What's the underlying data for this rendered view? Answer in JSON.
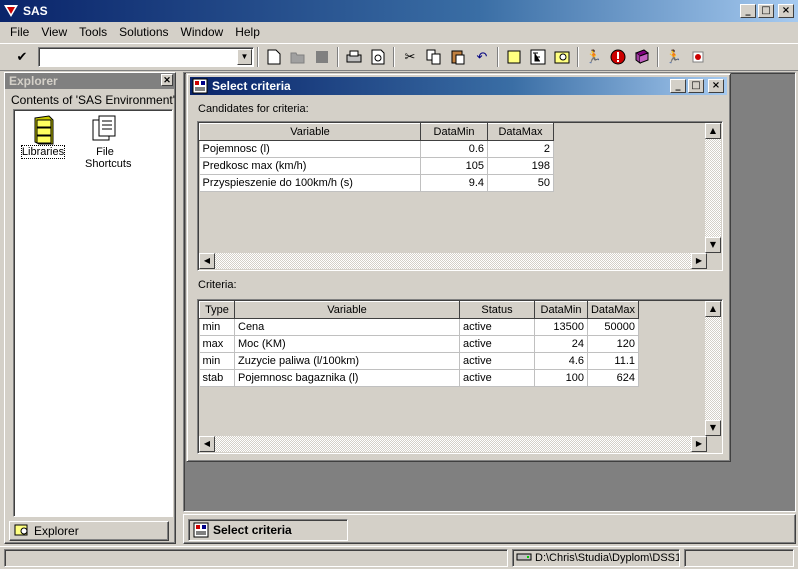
{
  "app": {
    "title": "SAS"
  },
  "menu": [
    "File",
    "View",
    "Tools",
    "Solutions",
    "Window",
    "Help"
  ],
  "toolbar": {
    "command_value": ""
  },
  "explorer": {
    "header": "Explorer",
    "contents_label": "Contents of 'SAS Environment'",
    "items": [
      {
        "label": "Libraries",
        "icon": "cabinet-icon"
      },
      {
        "label": "File Shortcuts",
        "icon": "file-shortcuts-icon"
      }
    ],
    "tab_label": "Explorer"
  },
  "child_window": {
    "title": "Select criteria",
    "candidates_label": "Candidates for criteria:",
    "candidates_columns": [
      "Variable",
      "DataMin",
      "DataMax"
    ],
    "candidates_rows": [
      {
        "variable": "Pojemnosc (l)",
        "datamin": "0.6",
        "datamax": "2"
      },
      {
        "variable": "Predkosc max (km/h)",
        "datamin": "105",
        "datamax": "198"
      },
      {
        "variable": "Przyspieszenie do 100km/h (s)",
        "datamin": "9.4",
        "datamax": "50"
      }
    ],
    "criteria_label": "Criteria:",
    "criteria_columns": [
      "Type",
      "Variable",
      "Status",
      "DataMin",
      "DataMax"
    ],
    "criteria_rows": [
      {
        "type": "min",
        "variable": "Cena",
        "status": "active",
        "datamin": "13500",
        "datamax": "50000"
      },
      {
        "type": "max",
        "variable": "Moc (KM)",
        "status": "active",
        "datamin": "24",
        "datamax": "120"
      },
      {
        "type": "min",
        "variable": "Zuzycie paliwa (l/100km)",
        "status": "active",
        "datamin": "4.6",
        "datamax": "11.1"
      },
      {
        "type": "stab",
        "variable": "Pojemnosc bagaznika (l)",
        "status": "active",
        "datamin": "100",
        "datamax": "624"
      }
    ]
  },
  "taskbar": {
    "item_label": "Select criteria"
  },
  "status": {
    "path": "D:\\Chris\\Studia\\Dyplom\\DSS1("
  },
  "colors": {
    "titlebar": "#0a246a",
    "face": "#d4d0c8",
    "mdi_bg": "#808080"
  }
}
